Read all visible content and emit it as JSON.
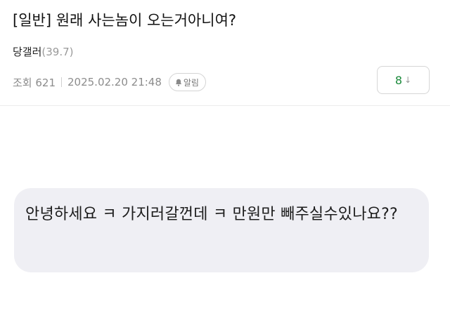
{
  "post": {
    "title": "[일반] 원래 사는놈이 오는거아니여?",
    "author": "당갤러",
    "author_score": "(39.7)",
    "views": "조회 621",
    "datetime": "2025.02.20 21:48",
    "alarm_label": "알림",
    "comment_count": "8",
    "comment_arrow": "↓"
  },
  "message": {
    "text": "안녕하세요 ㅋ 가지러갈껀데 ㅋ 만원만 빼주실수있나요??"
  },
  "icons": {
    "alarm": "bell-icon",
    "comment": "arrow-down-icon"
  },
  "colors": {
    "comment_count": "#1b8a3b",
    "bubble_background": "#efeff4",
    "meta_text": "#8c8c8c"
  }
}
